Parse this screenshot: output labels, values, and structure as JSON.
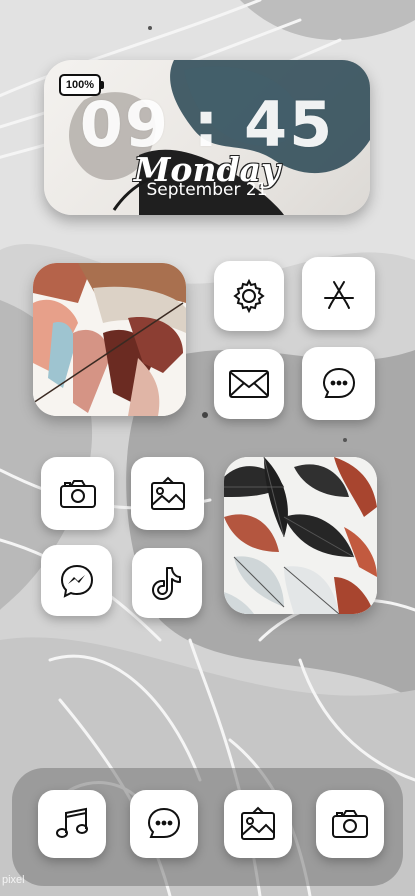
{
  "status": {
    "battery_label": "100%"
  },
  "clock_widget": {
    "time": "09 : 45",
    "day": "Monday",
    "date": "September 21"
  },
  "home_grid": {
    "row1_right": [
      {
        "name": "settings",
        "icon": "gear-icon"
      },
      {
        "name": "app-store",
        "icon": "app-store-icon"
      },
      {
        "name": "mail",
        "icon": "envelope-icon"
      },
      {
        "name": "messages",
        "icon": "chat-bubble-icon"
      }
    ],
    "row2_left": [
      {
        "name": "camera",
        "icon": "camera-icon"
      },
      {
        "name": "photos",
        "icon": "picture-icon"
      },
      {
        "name": "messenger",
        "icon": "messenger-icon"
      },
      {
        "name": "tiktok",
        "icon": "tiktok-icon"
      }
    ]
  },
  "dock": [
    {
      "name": "music",
      "icon": "music-note-icon"
    },
    {
      "name": "messages",
      "icon": "chat-bubble-icon"
    },
    {
      "name": "photos",
      "icon": "picture-icon"
    },
    {
      "name": "camera",
      "icon": "camera-icon"
    }
  ],
  "watermark": "pixel"
}
